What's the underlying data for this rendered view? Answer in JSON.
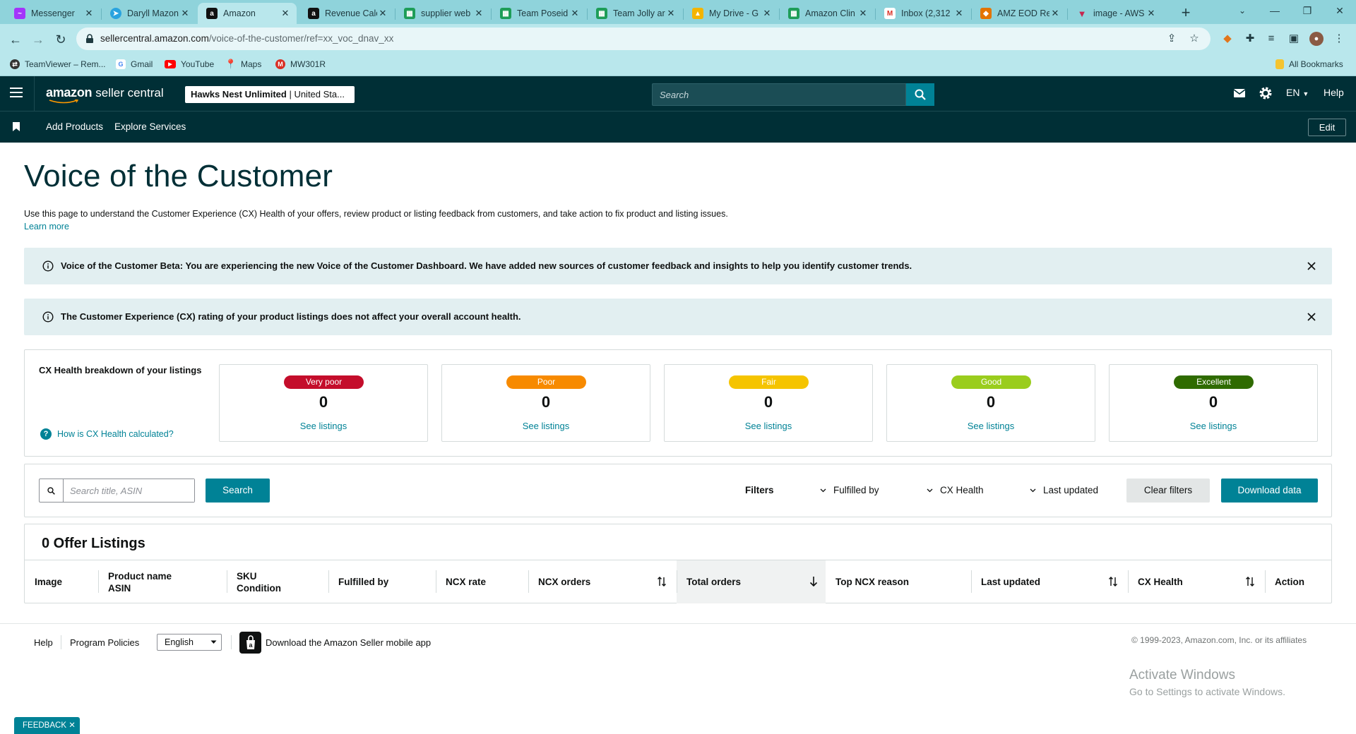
{
  "browser": {
    "tabs": [
      {
        "label": "Messenger",
        "icon": "messenger-icon",
        "color": "#a334fa"
      },
      {
        "label": "Daryll Mazon",
        "icon": "telegram-icon",
        "color": "#2aa3df"
      },
      {
        "label": "Amazon",
        "icon": "amazon-icon",
        "color": "#111111",
        "active": true
      },
      {
        "label": "Revenue Calc",
        "icon": "amazon-icon",
        "color": "#111111"
      },
      {
        "label": "supplier web",
        "icon": "sheets-icon",
        "color": "#1e9d58"
      },
      {
        "label": "Team Poseid",
        "icon": "sheets-icon",
        "color": "#1e9d58"
      },
      {
        "label": "Team Jolly ar",
        "icon": "sheets-icon",
        "color": "#1e9d58"
      },
      {
        "label": "My Drive - G",
        "icon": "drive-icon",
        "color": "#f4b400"
      },
      {
        "label": "Amazon Clin",
        "icon": "sheets-icon",
        "color": "#1e9d58"
      },
      {
        "label": "Inbox (2,312",
        "icon": "gmail-icon",
        "color": "#d93025"
      },
      {
        "label": "AMZ EOD Re",
        "icon": "slides-icon",
        "color": "#e37400"
      },
      {
        "label": "image - AWS",
        "icon": "aws-icon",
        "color": "#c7254e"
      }
    ],
    "url_host": "sellercentral.amazon.com",
    "url_path": "/voice-of-the-customer/ref=xx_voc_dnav_xx",
    "bookmarks": [
      {
        "label": "TeamViewer – Rem...",
        "icon": "teamviewer-icon",
        "color": "#333333"
      },
      {
        "label": "Gmail",
        "icon": "google-icon",
        "color": "#4285f4"
      },
      {
        "label": "YouTube",
        "icon": "youtube-icon",
        "color": "#ff0000"
      },
      {
        "label": "Maps",
        "icon": "maps-icon",
        "color": "#34a853"
      },
      {
        "label": "MW301R",
        "icon": "mercusys-icon",
        "color": "#d93025"
      }
    ],
    "all_bookmarks": "All Bookmarks"
  },
  "header": {
    "logo_brand": "amazon",
    "logo_product": "seller central",
    "account_name": "Hawks Nest Unlimited",
    "account_region": "United Sta...",
    "search_placeholder": "Search",
    "language": "EN",
    "help": "Help",
    "subnav": [
      "Add Products",
      "Explore Services"
    ],
    "edit": "Edit"
  },
  "page": {
    "title": "Voice of the Customer",
    "description": "Use this page to understand the Customer Experience (CX) Health of your offers, review product or listing feedback from customers, and take action to fix product and listing issues.",
    "learn_more": "Learn more",
    "alerts": [
      "Voice of the Customer Beta: You are experiencing the new Voice of the Customer Dashboard. We have added new sources of customer feedback and insights to help you identify customer trends.",
      "The Customer Experience (CX) rating of your product listings does not affect your overall account health."
    ]
  },
  "cx_health": {
    "title": "CX Health breakdown of your listings",
    "help_link": "How is CX Health calculated?",
    "cards": [
      {
        "label": "Very poor",
        "count": "0",
        "link": "See listings",
        "color": "#c40d2b"
      },
      {
        "label": "Poor",
        "count": "0",
        "link": "See listings",
        "color": "#f78a00"
      },
      {
        "label": "Fair",
        "count": "0",
        "link": "See listings",
        "color": "#f5c400"
      },
      {
        "label": "Good",
        "count": "0",
        "link": "See listings",
        "color": "#9acd1d"
      },
      {
        "label": "Excellent",
        "count": "0",
        "link": "See listings",
        "color": "#2f6b00"
      }
    ]
  },
  "filters": {
    "search_placeholder": "Search title, ASIN",
    "search_button": "Search",
    "label": "Filters",
    "dropdowns": [
      "Fulfilled by",
      "CX Health",
      "Last updated"
    ],
    "clear": "Clear filters",
    "download": "Download data"
  },
  "offers": {
    "title": "0 Offer Listings",
    "columns": [
      {
        "line1": "Image"
      },
      {
        "line1": "Product name",
        "line2": "ASIN"
      },
      {
        "line1": "SKU",
        "line2": "Condition"
      },
      {
        "line1": "Fulfilled by"
      },
      {
        "line1": "NCX rate"
      },
      {
        "line1": "NCX orders"
      },
      {
        "line1": "Total orders"
      },
      {
        "line1": "Top NCX reason"
      },
      {
        "line1": "Last updated"
      },
      {
        "line1": "CX Health"
      },
      {
        "line1": "Action"
      }
    ]
  },
  "footer": {
    "help": "Help",
    "program_policies": "Program Policies",
    "language": "English",
    "app_text": "Download the Amazon Seller mobile app",
    "copyright": "© 1999-2023, Amazon.com, Inc. or its affiliates"
  },
  "watermark": {
    "line1": "Activate Windows",
    "line2": "Go to Settings to activate Windows."
  },
  "feedback": "FEEDBACK"
}
